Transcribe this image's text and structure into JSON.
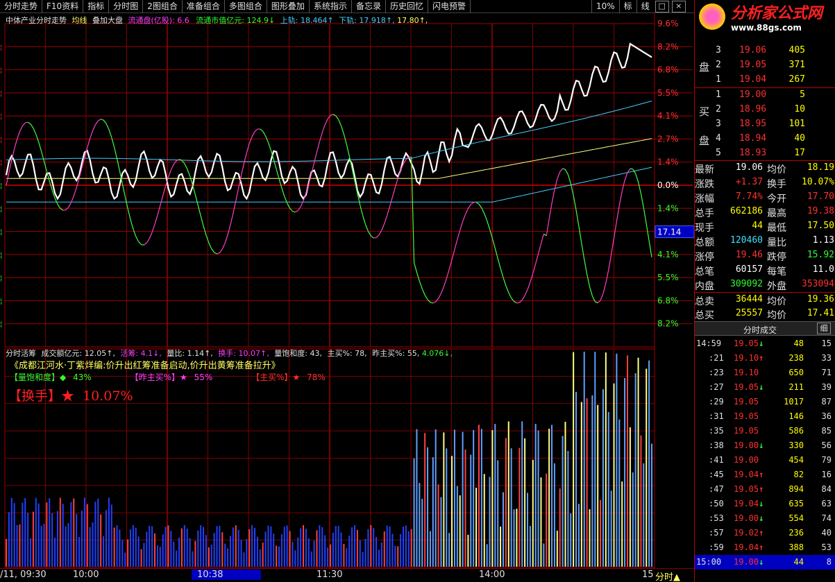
{
  "toolbar": {
    "items": [
      "分时走势",
      "F10资料",
      "指标",
      "分时图",
      "2图组合",
      "准备组合",
      "多图组合",
      "图形叠加",
      "系统指示",
      "备忘录",
      "历史回忆",
      "闪电预警"
    ],
    "right": [
      "10%",
      "标",
      "线"
    ]
  },
  "header": {
    "title": "中体产业分时走势",
    "avg_label": "均线",
    "overlay_label": "叠加大盘",
    "float_cap_label": "流通盘(亿股):",
    "float_cap_value": "6.6",
    "float_mkt_label": "流通市值亿元:",
    "float_mkt_value": "124.9↓",
    "upper_label": "上轨:",
    "upper_value": "18.464↑",
    "lower_label": "下轨:",
    "lower_value": "17.918↑,",
    "extra_value": "17.80↑,"
  },
  "pct_labels_up": [
    "9.6%",
    "8.2%",
    "6.8%",
    "5.5%",
    "4.1%",
    "2.7%",
    "1.4%",
    "0.0%"
  ],
  "pct_labels_down": [
    "1.4%",
    "4.1%",
    "5.5%",
    "6.8%",
    "8.2%"
  ],
  "cursor_price": "17.14",
  "sub_header": {
    "title": "分时活筹",
    "amount_label": "成交额亿元:",
    "amount_value": "12.05↑,",
    "active_label": "活筹:",
    "active_value": "4.1↓,",
    "ratio_label": "量比:",
    "ratio_value": "1.14↑,",
    "turnover_label": "换手:",
    "turnover_value": "10.07↑,",
    "saturation_label": "量饱和度:",
    "saturation_value": "43,",
    "mainbuy_label": "主买%:",
    "mainbuy_value": "78,",
    "prevmain_label": "昨主买%:",
    "prevmain_value": "55,",
    "extra": "4.076↓,"
  },
  "annotation": {
    "line1": "《成都江河水·丁紫烊编:价升出红筹准备启动,价升出黄筹准备拉升》",
    "sat_label": "【量饱和度】◆",
    "sat_value": "43%",
    "prev_label": "【昨主买%】★",
    "prev_value": "55%",
    "main_label": "【主买%】★",
    "main_value": "78%",
    "turn_label": "【换手】★",
    "turn_value": "10.07%"
  },
  "time_axis": [
    "/11, 09:30",
    "10:00",
    "10:38",
    "11:30",
    "14:00",
    "15"
  ],
  "bottom_tab": "分时▲",
  "logo": {
    "title": "分析家公式网",
    "url": "www.88gs.com"
  },
  "sell_book": [
    {
      "side": "",
      "level": "3",
      "price": "19.06",
      "vol": "405"
    },
    {
      "side": "盘",
      "level": "2",
      "price": "19.05",
      "vol": "371"
    },
    {
      "side": "",
      "level": "1",
      "price": "19.04",
      "vol": "267"
    }
  ],
  "buy_book": [
    {
      "side": "",
      "level": "1",
      "price": "19.00",
      "vol": "5"
    },
    {
      "side": "买",
      "level": "2",
      "price": "18.96",
      "vol": "10"
    },
    {
      "side": "",
      "level": "3",
      "price": "18.95",
      "vol": "101"
    },
    {
      "side": "盘",
      "level": "4",
      "price": "18.94",
      "vol": "40"
    },
    {
      "side": "",
      "level": "5",
      "price": "18.93",
      "vol": "17"
    }
  ],
  "quote": [
    {
      "l1": "最新",
      "v1": "19.06",
      "l2": "均价",
      "v2": "18.19",
      "c1": "#ffffff",
      "c2": "#ffff00"
    },
    {
      "l1": "涨跌",
      "v1": "+1.37",
      "l2": "换手",
      "v2": "10.07%",
      "c1": "#ff3030",
      "c2": "#ffff00"
    },
    {
      "l1": "涨幅",
      "v1": "7.74%",
      "l2": "今开",
      "v2": "17.70",
      "c1": "#ff3030",
      "c2": "#ff3030"
    },
    {
      "l1": "总手",
      "v1": "662186",
      "l2": "最高",
      "v2": "19.38",
      "c1": "#ffff00",
      "c2": "#ff3030"
    },
    {
      "l1": "现手",
      "v1": "44",
      "l2": "最低",
      "v2": "17.50",
      "c1": "#ffff00",
      "c2": "#ffff00"
    },
    {
      "l1": "总额",
      "v1": "120460",
      "l2": "量比",
      "v2": "1.13",
      "c1": "#40e0ff",
      "c2": "#ffffff"
    },
    {
      "l1": "涨停",
      "v1": "19.46",
      "l2": "跌停",
      "v2": "15.92",
      "c1": "#ff3030",
      "c2": "#30ff30"
    },
    {
      "l1": "总笔",
      "v1": "60157",
      "l2": "每笔",
      "v2": "11.0",
      "c1": "#ffffff",
      "c2": "#ffffff"
    },
    {
      "l1": "内盘",
      "v1": "309092",
      "l2": "外盘",
      "v2": "353094",
      "c1": "#30ff30",
      "c2": "#ff3030"
    },
    {
      "l1": "总卖",
      "v1": "36444",
      "l2": "均价",
      "v2": "19.36",
      "c1": "#ffff00",
      "c2": "#ffff00"
    },
    {
      "l1": "总买",
      "v1": "25557",
      "l2": "均价",
      "v2": "17.41",
      "c1": "#ffff00",
      "c2": "#ffff00"
    }
  ],
  "ticks_header": "分时成交",
  "ticks": [
    {
      "t": "14:59",
      "p": "19.05",
      "d": "↓",
      "v": "48",
      "n": "15"
    },
    {
      "t": ":21",
      "p": "19.10",
      "d": "↑",
      "v": "238",
      "n": "33"
    },
    {
      "t": ":23",
      "p": "19.10",
      "d": "",
      "v": "650",
      "n": "71"
    },
    {
      "t": ":27",
      "p": "19.05",
      "d": "↓",
      "v": "211",
      "n": "39"
    },
    {
      "t": ":29",
      "p": "19.05",
      "d": "",
      "v": "1017",
      "n": "87"
    },
    {
      "t": ":31",
      "p": "19.05",
      "d": "",
      "v": "146",
      "n": "36"
    },
    {
      "t": ":35",
      "p": "19.05",
      "d": "",
      "v": "586",
      "n": "85"
    },
    {
      "t": ":38",
      "p": "19.00",
      "d": "↓",
      "v": "330",
      "n": "56"
    },
    {
      "t": ":41",
      "p": "19.00",
      "d": "",
      "v": "454",
      "n": "79"
    },
    {
      "t": ":45",
      "p": "19.04",
      "d": "↑",
      "v": "82",
      "n": "16"
    },
    {
      "t": ":47",
      "p": "19.05",
      "d": "↑",
      "v": "894",
      "n": "84"
    },
    {
      "t": ":50",
      "p": "19.04",
      "d": "↓",
      "v": "635",
      "n": "63"
    },
    {
      "t": ":53",
      "p": "19.00",
      "d": "↓",
      "v": "554",
      "n": "74"
    },
    {
      "t": ":57",
      "p": "19.02",
      "d": "↑",
      "v": "236",
      "n": "40"
    },
    {
      "t": ":59",
      "p": "19.04",
      "d": "↑",
      "v": "388",
      "n": "53"
    },
    {
      "t": "15:00",
      "p": "19.00",
      "d": "↓",
      "v": "44",
      "n": "8"
    }
  ],
  "colors": {
    "grid": "#a00000",
    "price": "#ffffff",
    "avg": "#ffff80",
    "upper": "#40d0ff",
    "up": "#ff3030",
    "down": "#30ff30"
  }
}
